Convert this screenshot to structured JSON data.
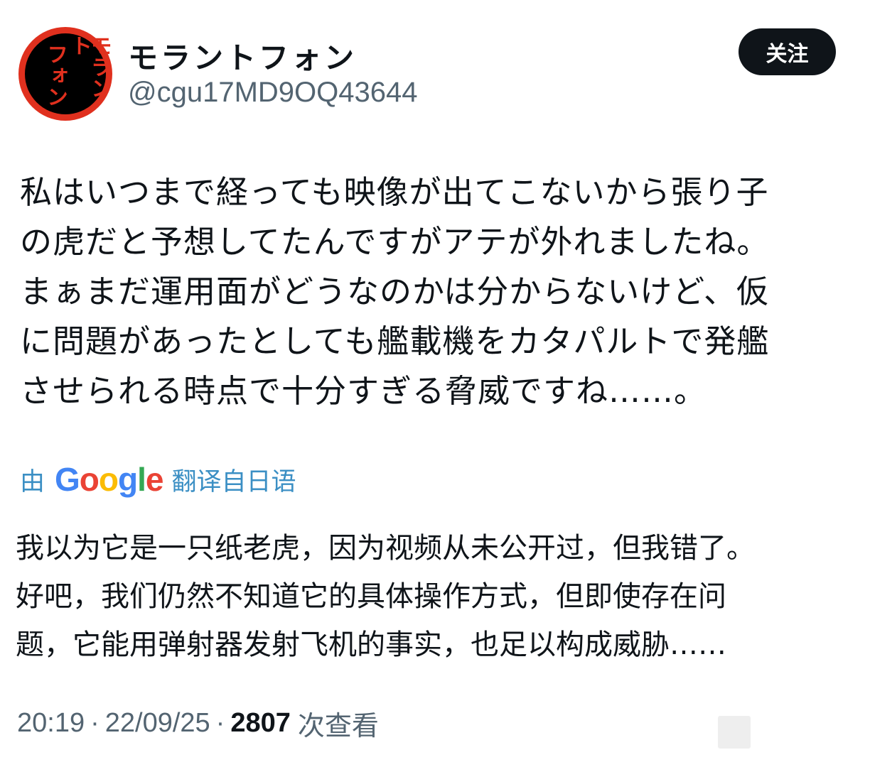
{
  "author": {
    "display_name": "モラントフォン",
    "handle": "@cgu17MD9OQ43644",
    "avatar_text_col1": "モラント",
    "avatar_text_col2": "フォン"
  },
  "follow_button": {
    "label": "关注"
  },
  "tweet": {
    "text_lines": [
      "私はいつまで経っても映像が出てこないから張り子",
      "の虎だと予想してたんですがアテが外れましたね。",
      "まぁまだ運用面がどうなのかは分からないけど、仮",
      "に問題があったとしても艦載機をカタパルトで発艦",
      "させられる時点で十分すぎる脅威ですね……。"
    ]
  },
  "translation": {
    "by_label": "由",
    "provider": "Google",
    "from_label": "翻译自日语",
    "text_lines": [
      "我以为它是一只纸老虎，因为视频从未公开过，但我错了。",
      "好吧，我们仍然不知道它的具体操作方式，但即使存在问",
      "题，它能用弹射器发射飞机的事实，也足以构成威胁……"
    ]
  },
  "meta": {
    "time": "20:19",
    "date": "22/09/25",
    "separator": "·",
    "views_count": "2807",
    "views_label": "次查看"
  },
  "colors": {
    "follow_bg": "#0f1419",
    "link_blue": "#3b8fc4",
    "avatar_red": "#e0301e"
  }
}
